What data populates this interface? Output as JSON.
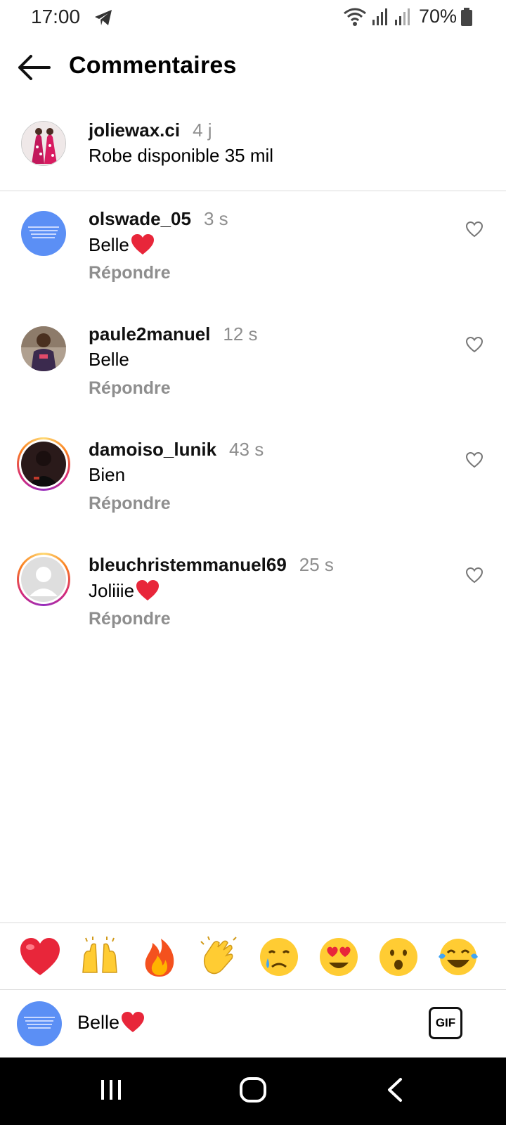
{
  "status_bar": {
    "time": "17:00",
    "battery": "70%",
    "icons": [
      "telegram-icon",
      "wifi-icon",
      "signal-icon",
      "signal-icon",
      "battery-icon"
    ]
  },
  "header": {
    "title": "Commentaires",
    "back_icon": "arrow-left-icon"
  },
  "caption": {
    "username": "joliewax.ci",
    "time": "4 j",
    "text": "Robe disponible 35 mil"
  },
  "comments": [
    {
      "username": "olswade_05",
      "time": "3 s",
      "text": "Belle",
      "has_heart_emoji": true,
      "reply": "Répondre",
      "story_ring": false,
      "avatar_color": "#5b8ff5"
    },
    {
      "username": "paule2manuel",
      "time": "12 s",
      "text": "Belle",
      "has_heart_emoji": false,
      "reply": "Répondre",
      "story_ring": false,
      "avatar_color": "#8a6f5c"
    },
    {
      "username": "damoiso_lunik",
      "time": "43 s",
      "text": "Bien",
      "has_heart_emoji": false,
      "reply": "Répondre",
      "story_ring": true,
      "avatar_color": "#2a1a1a"
    },
    {
      "username": "bleuchristemmanuel69",
      "time": "25 s",
      "text": "Joliiie",
      "has_heart_emoji": true,
      "reply": "Répondre",
      "story_ring": true,
      "avatar_color": "#dddddd"
    }
  ],
  "reactions": [
    "red-heart-emoji",
    "raising-hands-emoji",
    "fire-emoji",
    "clapping-hands-emoji",
    "crying-face-emoji",
    "heart-eyes-emoji",
    "surprised-face-emoji",
    "tears-of-joy-emoji"
  ],
  "composer": {
    "text": "Belle",
    "gif_label": "GIF"
  },
  "colors": {
    "secondary_text": "#8e8e8e",
    "divider": "#dbdbdb",
    "heart_red": "#e8263a",
    "emoji_yellow": "#ffcc33"
  }
}
